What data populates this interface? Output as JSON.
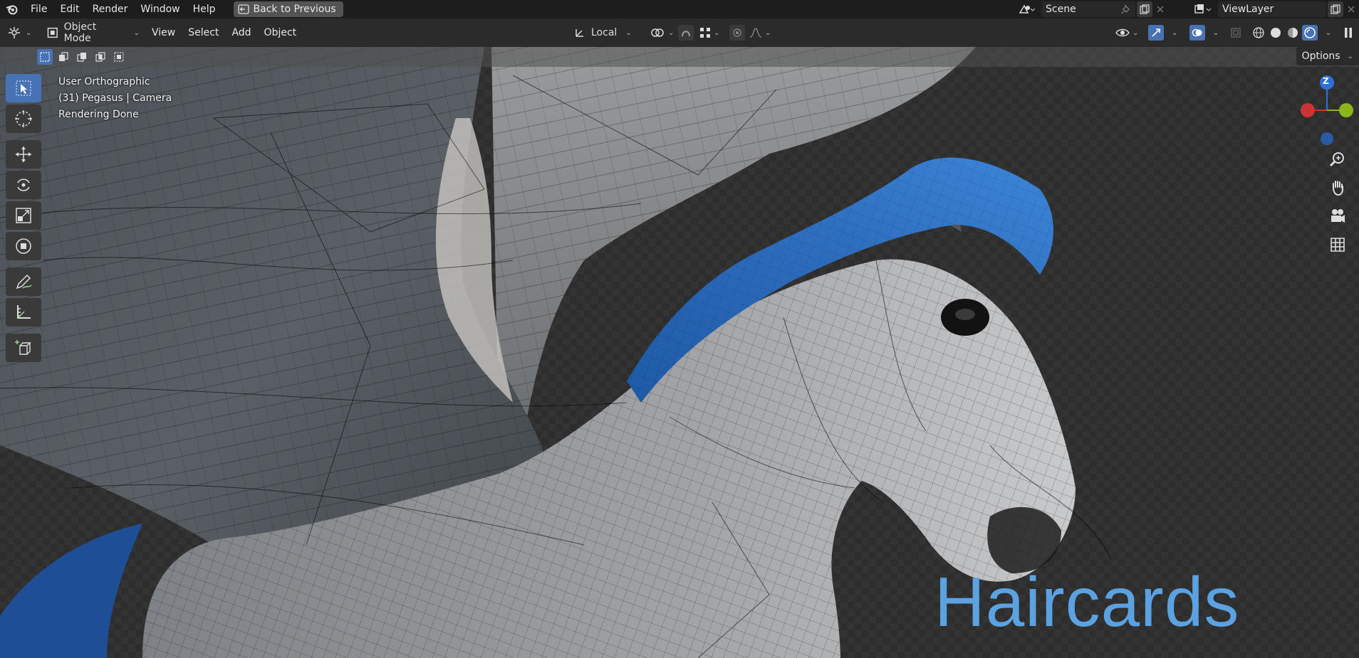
{
  "menu": {
    "items": [
      "File",
      "Edit",
      "Render",
      "Window",
      "Help"
    ],
    "back_button": "Back to Previous"
  },
  "scene": {
    "label": "Scene"
  },
  "view_layer": {
    "label": "ViewLayer"
  },
  "header": {
    "mode": "Object Mode",
    "menus": [
      "View",
      "Select",
      "Add",
      "Object"
    ],
    "transform_orientation": "Local"
  },
  "viewport": {
    "info": [
      "User Orthographic",
      "(31) Pegasus | Camera",
      "Rendering Done"
    ],
    "options_label": "Options",
    "overlay_title": "Haircards",
    "gizmo": {
      "z_label": "Z"
    }
  },
  "colors": {
    "accent": "#4772b3",
    "title": "#5ba2e3",
    "mane": "#2f6fc0"
  }
}
